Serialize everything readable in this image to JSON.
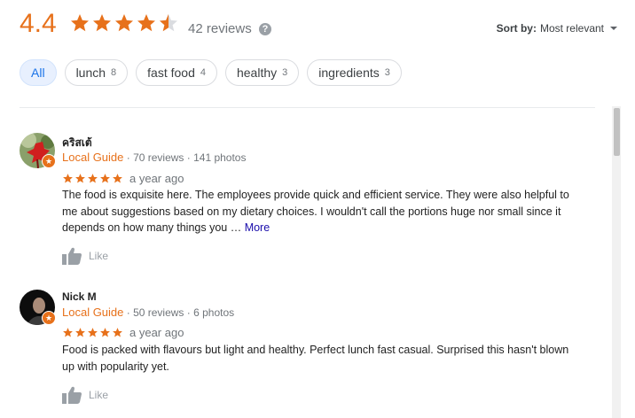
{
  "summary": {
    "rating": "4.4",
    "stars": 4.4,
    "review_count": "42 reviews",
    "help_icon": "?"
  },
  "sort": {
    "label": "Sort by:",
    "value": "Most relevant"
  },
  "chips": [
    {
      "label": "All",
      "count": ""
    },
    {
      "label": "lunch",
      "count": "8"
    },
    {
      "label": "fast food",
      "count": "4"
    },
    {
      "label": "healthy",
      "count": "3"
    },
    {
      "label": "ingredients",
      "count": "3"
    }
  ],
  "reviews": [
    {
      "name": "คริสเต้",
      "badge": "Local Guide",
      "reviews": "· 70 reviews",
      "photos": "· 141 photos",
      "stars": 5,
      "ago": "a year ago",
      "text_lines": [
        "The food is exquisite here. The employees provide quick and efficient service. They were also helpful to",
        "me about suggestions based on my dietary choices. I wouldn't call the portions huge nor small since it",
        "depends on how many things you … "
      ],
      "more": "More",
      "like": "Like"
    },
    {
      "name": "Nick M",
      "badge": "Local Guide",
      "reviews": "· 50 reviews",
      "photos": "· 6 photos",
      "stars": 5,
      "ago": "a year ago",
      "text_lines": [
        "Food is packed with flavours but light and healthy. Perfect lunch fast casual. Surprised this hasn't blown",
        "up with popularity yet."
      ],
      "like": "Like"
    }
  ],
  "colors": {
    "star": "#e7711b",
    "star_empty": "#dadce0",
    "link": "#1a0dab",
    "chip_active": "#1a73e8"
  }
}
